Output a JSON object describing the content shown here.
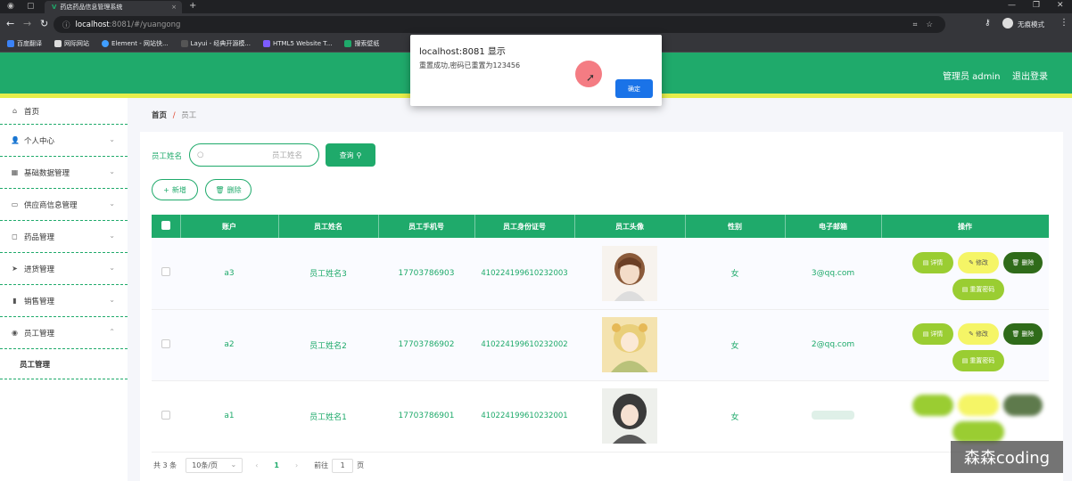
{
  "browser": {
    "tab_title": "药店药品信息管理系统",
    "url_host": "localhost",
    "url_rest": ":8081/#/yuangong",
    "incognito_label": "无痕模式",
    "bookmarks": [
      "百度翻译",
      "网际网站",
      "Element - 网站快...",
      "Layui - 经典开源模...",
      "HTML5 Website T...",
      "搜索壁纸"
    ]
  },
  "header": {
    "admin_label": "管理员 admin",
    "logout_label": "退出登录"
  },
  "sidebar": {
    "items": [
      {
        "label": "首页",
        "icon": "home-icon",
        "glyph": "⌂"
      },
      {
        "label": "个人中心",
        "icon": "user-icon",
        "glyph": "👤"
      },
      {
        "label": "基础数据管理",
        "icon": "database-icon",
        "glyph": "▦"
      },
      {
        "label": "供应商信息管理",
        "icon": "monitor-icon",
        "glyph": "▭"
      },
      {
        "label": "药品管理",
        "icon": "pill-icon",
        "glyph": "◻"
      },
      {
        "label": "进货管理",
        "icon": "send-icon",
        "glyph": "➤"
      },
      {
        "label": "销售管理",
        "icon": "bar-chart-icon",
        "glyph": "▮"
      },
      {
        "label": "员工管理",
        "icon": "mic-icon",
        "glyph": "◉"
      }
    ],
    "sub_item": "员工管理"
  },
  "breadcrumb": {
    "home": "首页",
    "sep": "/",
    "current": "员工"
  },
  "search": {
    "label": "员工姓名",
    "placeholder": "员工姓名",
    "query_button": "查询"
  },
  "actions": {
    "add": "新增",
    "delete": "删除"
  },
  "table": {
    "columns": [
      "账户",
      "员工姓名",
      "员工手机号",
      "员工身份证号",
      "员工头像",
      "性别",
      "电子邮箱",
      "操作"
    ],
    "rows": [
      {
        "account": "a3",
        "name": "员工姓名3",
        "phone": "17703786903",
        "id_card": "410224199610232003",
        "gender": "女",
        "email": "3@qq.com"
      },
      {
        "account": "a2",
        "name": "员工姓名2",
        "phone": "17703786902",
        "id_card": "410224199610232002",
        "gender": "女",
        "email": "2@qq.com"
      },
      {
        "account": "a1",
        "name": "员工姓名1",
        "phone": "17703786901",
        "id_card": "410224199610232001",
        "gender": "女",
        "email": ""
      }
    ],
    "op_labels": {
      "detail": "详情",
      "edit": "修改",
      "delete": "删除",
      "reset": "重置密码"
    }
  },
  "pager": {
    "total": "共 3 条",
    "page_size": "10条/页",
    "current_page": "1",
    "goto_label": "前往",
    "goto_value": "1",
    "page_unit": "页"
  },
  "alert": {
    "title": "localhost:8081 显示",
    "message": "重置成功,密码已重置为123456",
    "ok": "确定"
  },
  "watermark": "森森coding",
  "colors": {
    "primary": "#1faa6b",
    "accent_yellow": "#e6ee4a",
    "detail_btn": "#9acd32",
    "edit_btn": "#f5f566",
    "delete_btn": "#2f6b1a"
  }
}
